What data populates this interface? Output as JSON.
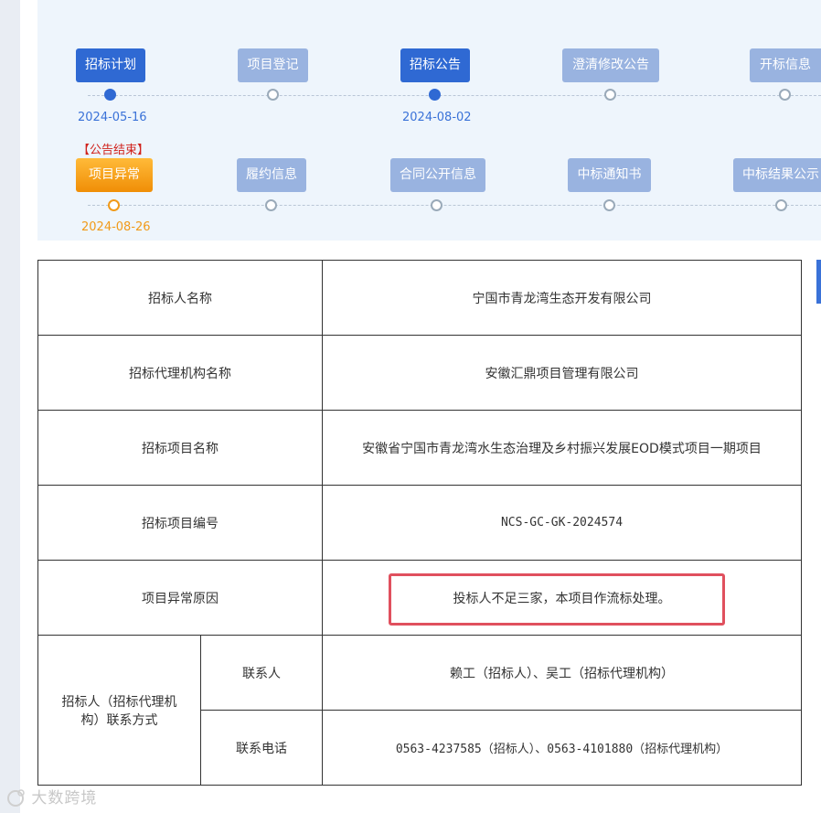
{
  "timeline": {
    "row1": [
      {
        "label": "招标计划",
        "state": "active",
        "date": "2024-05-16"
      },
      {
        "label": "项目登记",
        "state": "inactive",
        "date": ""
      },
      {
        "label": "招标公告",
        "state": "active",
        "date": "2024-08-02"
      },
      {
        "label": "澄清修改公告",
        "state": "inactive",
        "date": ""
      },
      {
        "label": "开标信息",
        "state": "inactive",
        "date": ""
      }
    ],
    "row2": [
      {
        "label": "项目异常",
        "state": "warn",
        "date": "2024-08-26",
        "note": "【公告结束】"
      },
      {
        "label": "履约信息",
        "state": "inactive",
        "date": ""
      },
      {
        "label": "合同公开信息",
        "state": "inactive",
        "date": ""
      },
      {
        "label": "中标通知书",
        "state": "inactive",
        "date": ""
      },
      {
        "label": "中标结果公示",
        "state": "inactive",
        "date": ""
      }
    ]
  },
  "table": {
    "tenderer_label": "招标人名称",
    "tenderer_value": "宁国市青龙湾生态开发有限公司",
    "agency_label": "招标代理机构名称",
    "agency_value": "安徽汇鼎项目管理有限公司",
    "project_name_label": "招标项目名称",
    "project_name_value": "安徽省宁国市青龙湾水生态治理及乡村振兴发展EOD模式项目一期项目",
    "project_no_label": "招标项目编号",
    "project_no_value": "NCS-GC-GK-2024574",
    "reason_label": "项目异常原因",
    "reason_value": "投标人不足三家，本项目作流标处理。",
    "contact_group_label": "招标人（招标代理机构）联系方式",
    "contact_person_label": "联系人",
    "contact_person_value": "赖工（招标人）、吴工（招标代理机构）",
    "contact_phone_label": "联系电话",
    "contact_phone_value": "0563-4237585（招标人）、0563-4101880（招标代理机构）"
  },
  "watermark": "大数跨境",
  "colors": {
    "active": "#2f69d3",
    "inactive": "#99b3e0",
    "warn": "#f19a18",
    "highlight": "#e0505e"
  }
}
